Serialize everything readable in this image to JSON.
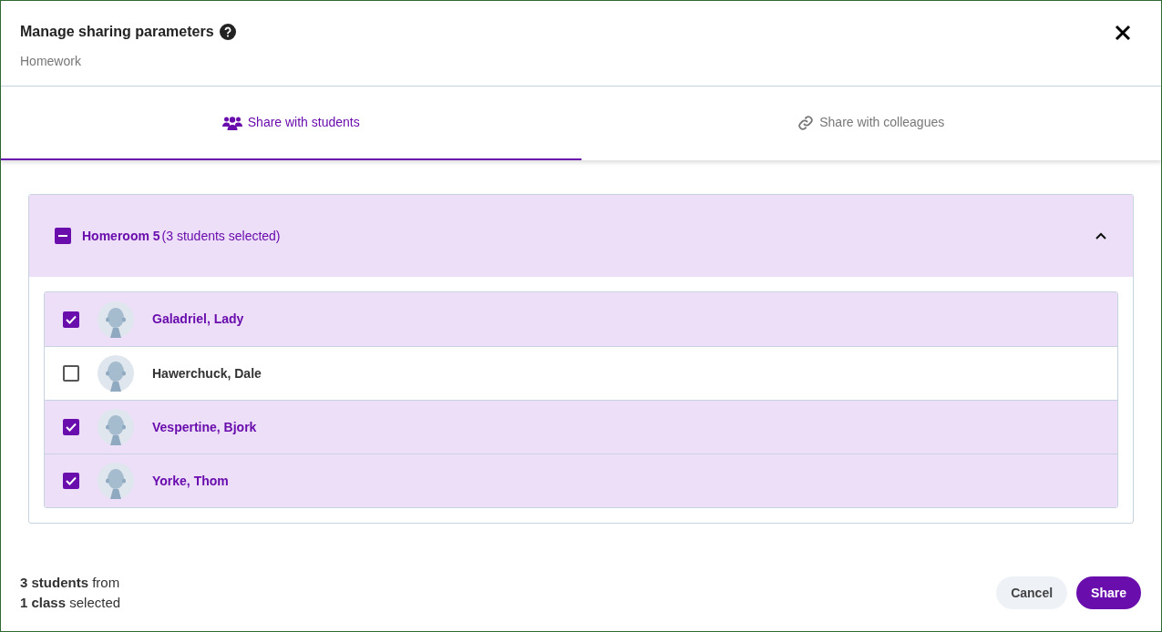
{
  "dialog": {
    "title": "Manage sharing parameters",
    "subtitle": "Homework"
  },
  "tabs": [
    {
      "label": "Share with students",
      "kind": "students",
      "selected": true
    },
    {
      "label": "Share with colleagues",
      "kind": "link",
      "selected": false
    }
  ],
  "group": {
    "name": "Homeroom 5",
    "count": "(3 students selected)",
    "indeterminate": true,
    "expanded": true,
    "students": [
      {
        "name": "Galadriel, Lady",
        "checked": true
      },
      {
        "name": "Hawerchuck, Dale",
        "checked": false
      },
      {
        "name": "Vespertine, Bjork",
        "checked": true
      },
      {
        "name": "Yorke, Thom",
        "checked": true
      }
    ]
  },
  "footer": {
    "summary": [
      "**3 students** from",
      "**1 class** selected"
    ],
    "buttons": [
      {
        "label": "Cancel",
        "kind": "secondary"
      },
      {
        "label": "Share",
        "kind": "primary"
      }
    ]
  }
}
